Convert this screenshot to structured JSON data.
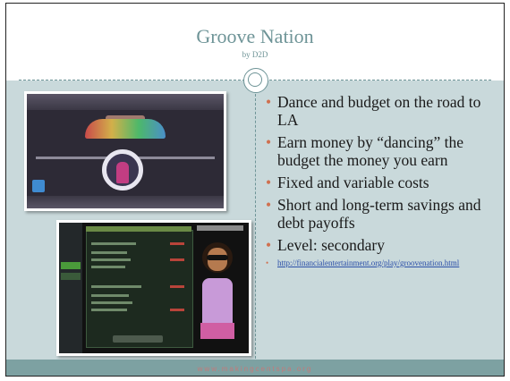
{
  "slide": {
    "title": "Groove Nation",
    "subtitle": "by D2D",
    "bullets": [
      "Dance and budget on the road to LA",
      "Earn money by “dancing” the budget the money you earn",
      "Fixed and variable costs",
      "Short and long-term savings and debt payoffs",
      "Level: secondary"
    ],
    "link": "http://financialentertainment.org/play/groovenation.html",
    "footer": "www.makingcentspa.org"
  },
  "images": {
    "game_screenshot": "groove-nation-dance-gameplay",
    "budget_screenshot": "groove-nation-budget-screen"
  },
  "colors": {
    "background": "#c9d9db",
    "title": "#6e9497",
    "bullet": "#d0704f",
    "footer_band": "#7da1a2",
    "footer_text": "#c47a7a",
    "link": "#2a4ea8"
  }
}
